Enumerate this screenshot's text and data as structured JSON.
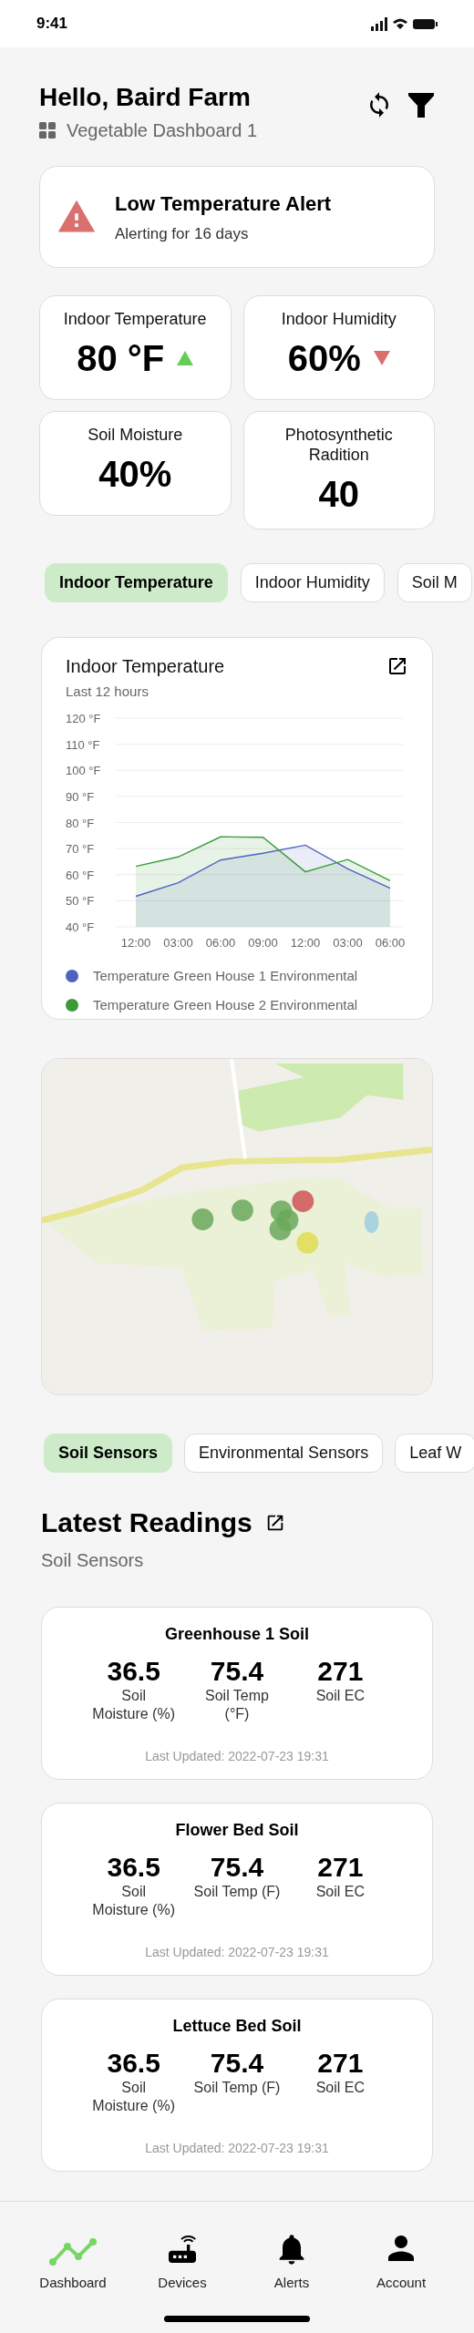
{
  "status_bar": {
    "time": "9:41"
  },
  "header": {
    "title": "Hello, Baird Farm",
    "subtitle": "Vegetable Dashboard 1"
  },
  "alert": {
    "title": "Low Temperature Alert",
    "message": "Alerting for 16 days"
  },
  "stats": [
    {
      "label": "Indoor Temperature",
      "value": "80 °F",
      "kind": "rising"
    },
    {
      "label": "Indoor Humidity",
      "value": "60%",
      "kind": "falling"
    },
    {
      "label": "Soil Moisture",
      "value": "40%",
      "kind": "plain"
    },
    {
      "label": "Photosynthetic Radition",
      "value": "40",
      "kind": "plain"
    }
  ],
  "metric_tabs": [
    {
      "label": "Indoor Temperature",
      "selected": true
    },
    {
      "label": "Indoor Humidity",
      "selected": false
    },
    {
      "label": "Soil M",
      "selected": false
    }
  ],
  "chart_card": {
    "title": "Indoor Temperature",
    "subtitle": "Last 12 hours",
    "chart_data": {
      "type": "area",
      "categories": [
        "12:00",
        "03:00",
        "06:00",
        "09:00",
        "12:00",
        "03:00",
        "06:00"
      ],
      "ylim": [
        40,
        120
      ],
      "grid": true,
      "yticks": [
        {
          "value": 40,
          "label": "40 °F"
        },
        {
          "value": 50,
          "label": "50 °F"
        },
        {
          "value": 60,
          "label": "60 °F"
        },
        {
          "value": 70,
          "label": "70 °F"
        },
        {
          "value": 80,
          "label": "80 °F"
        },
        {
          "value": 90,
          "label": "90 °F"
        },
        {
          "value": 100,
          "label": "100 °F"
        },
        {
          "value": 110,
          "label": "110 °F"
        },
        {
          "value": 120,
          "label": "120 °F"
        }
      ],
      "series": [
        {
          "name": "Temperature Green House 1 Environmental",
          "color": "#4f62c2",
          "values": [
            51.7,
            56.9,
            65.6,
            68.2,
            71.3,
            62.2,
            54.8
          ]
        },
        {
          "name": "Temperature Green House 2 Environmental",
          "color": "#3a9a3a",
          "values": [
            63.2,
            66.8,
            74.5,
            74.3,
            61.1,
            65.8,
            57.7
          ]
        }
      ]
    }
  },
  "sensor_tabs": [
    {
      "label": "Soil Sensors",
      "selected": true
    },
    {
      "label": "Environmental Sensors",
      "selected": false
    },
    {
      "label": "Leaf W",
      "selected": false
    }
  ],
  "readings": {
    "title": "Latest Readings",
    "subtitle": "Soil Sensors",
    "cards": [
      {
        "title": "Greenhouse 1 Soil",
        "values": [
          {
            "value": "36.5",
            "label": "Soil Moisture (%)"
          },
          {
            "value": "75.4",
            "label": "Soil Temp (°F)"
          },
          {
            "value": "271",
            "label": "Soil EC"
          }
        ],
        "updated": "Last Updated: 2022-07-23 19:31"
      },
      {
        "title": "Flower Bed Soil",
        "values": [
          {
            "value": "36.5",
            "label": "Soil Moisture (%)"
          },
          {
            "value": "75.4",
            "label": "Soil Temp (F)"
          },
          {
            "value": "271",
            "label": "Soil EC"
          }
        ],
        "updated": "Last Updated: 2022-07-23 19:31"
      },
      {
        "title": "Lettuce Bed Soil",
        "values": [
          {
            "value": "36.5",
            "label": "Soil Moisture (%)"
          },
          {
            "value": "75.4",
            "label": "Soil Temp (F)"
          },
          {
            "value": "271",
            "label": "Soil EC"
          }
        ],
        "updated": "Last Updated: 2022-07-23 19:31"
      }
    ]
  },
  "nav": [
    {
      "label": "Dashboard",
      "selected": true
    },
    {
      "label": "Devices",
      "selected": false
    },
    {
      "label": "Alerts",
      "selected": false
    },
    {
      "label": "Account",
      "selected": false
    }
  ]
}
